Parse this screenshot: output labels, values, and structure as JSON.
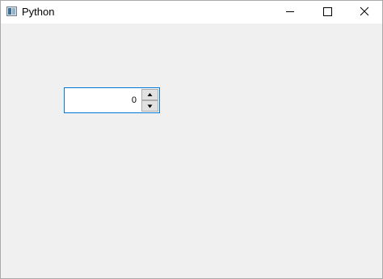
{
  "window": {
    "title": "Python",
    "icon": "python-app-icon",
    "controls": {
      "minimize_icon": "minimize-icon",
      "maximize_icon": "maximize-icon",
      "close_icon": "close-icon"
    }
  },
  "spinbox": {
    "value": "0",
    "up_icon": "arrow-up-icon",
    "down_icon": "arrow-down-icon"
  },
  "colors": {
    "client_background": "#f0f0f0",
    "focus_border": "#0078d7",
    "titlebar": "#ffffff"
  }
}
